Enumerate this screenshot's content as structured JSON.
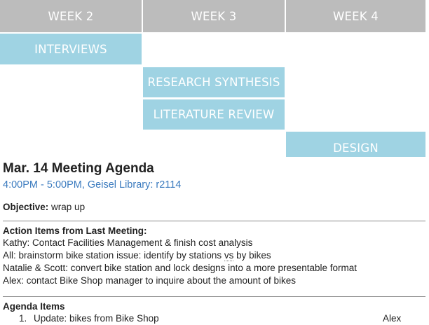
{
  "gantt": {
    "weeks": [
      "WEEK 2",
      "WEEK 3",
      "WEEK 4"
    ],
    "tasks": [
      "INTERVIEWS",
      "RESEARCH SYNTHESIS",
      "LITERATURE REVIEW",
      "DESIGN"
    ],
    "colors": {
      "header": "#bcbcbc",
      "task": "#9fd3e3"
    }
  },
  "meeting": {
    "title": "Mar. 14 Meeting Agenda",
    "time_location": "4:00PM - 5:00PM, Geisel Library: r2114",
    "objective_label": "Objective:",
    "objective_value": "wrap up"
  },
  "action_items": {
    "title": "Action Items from Last Meeting:",
    "items": [
      "Kathy: Contact Facilities Management & finish cost analysis",
      "All: brainstorm bike station issue: identify by stations ",
      "Natalie & Scott: convert bike station and lock designs into a more presentable format",
      "Alex: contact Bike Shop manager to inquire about the amount of bikes"
    ],
    "vs_word": "vs",
    "item2_tail": " by bikes"
  },
  "agenda": {
    "title": "Agenda Items",
    "items": [
      {
        "num": "1.",
        "text": "Update: bikes from Bike Shop",
        "owner": "Alex"
      }
    ]
  }
}
